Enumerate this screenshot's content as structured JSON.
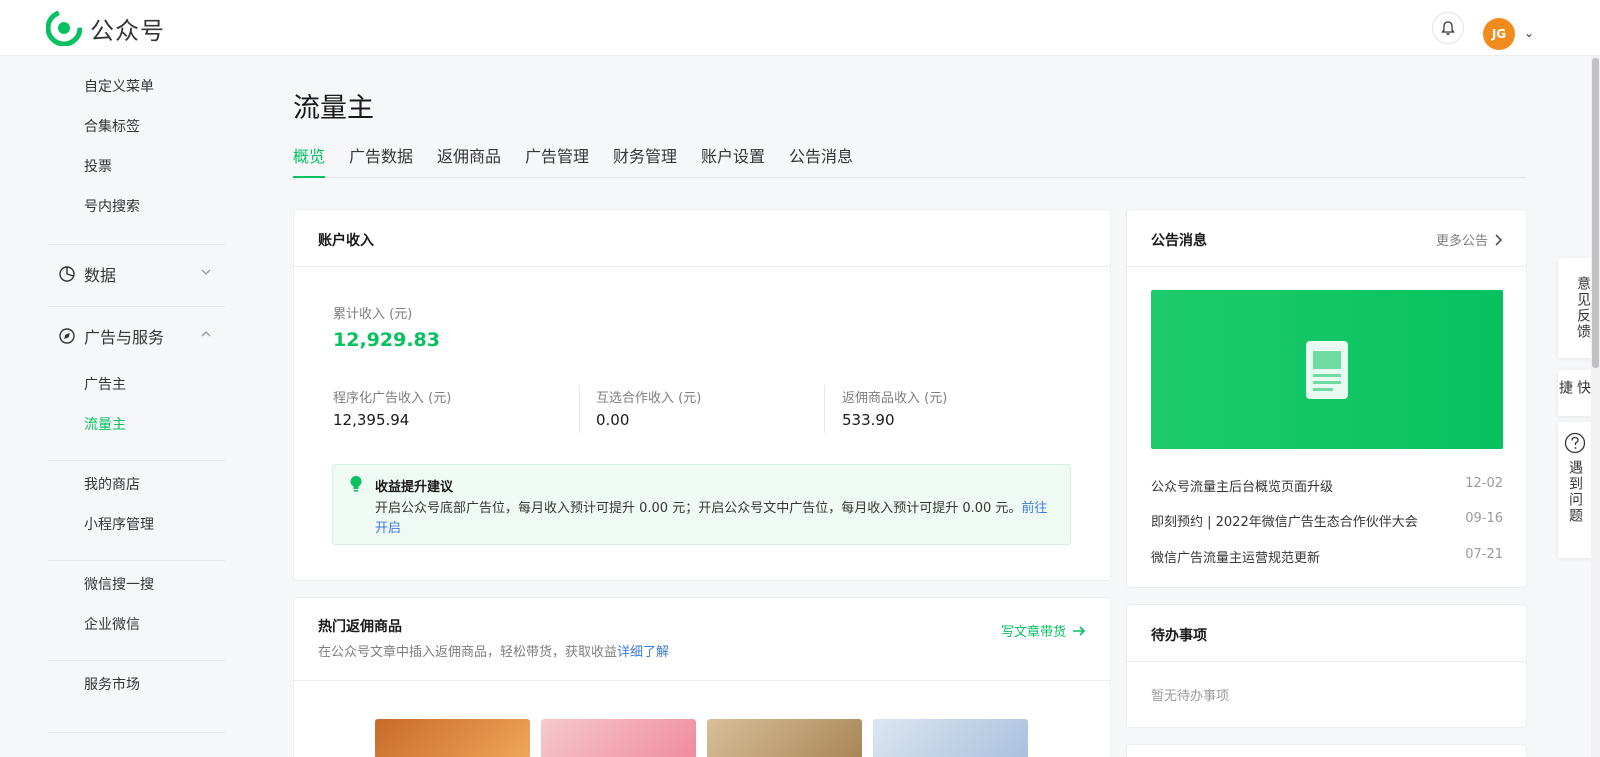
{
  "app": {
    "name": "公众号"
  },
  "header": {
    "avatar_initials": "JG"
  },
  "sidebar": {
    "items_top": [
      "自定义菜单",
      "合集标签",
      "投票",
      "号内搜索"
    ],
    "group_data": "数据",
    "group_ads": "广告与服务",
    "ads_items": [
      "广告主",
      "流量主"
    ],
    "items_mid": [
      "我的商店",
      "小程序管理"
    ],
    "items_mid2": [
      "微信搜一搜",
      "企业微信"
    ],
    "items_bottom": [
      "服务市场"
    ]
  },
  "page": {
    "title": "流量主",
    "tabs": [
      "概览",
      "广告数据",
      "返佣商品",
      "广告管理",
      "财务管理",
      "账户设置",
      "公告消息"
    ]
  },
  "income": {
    "title": "账户收入",
    "total_label": "累计收入 (元)",
    "total_value": "12,929.83",
    "program_label": "程序化广告收入 (元)",
    "program_value": "12,395.94",
    "mutual_label": "互选合作收入 (元)",
    "mutual_value": "0.00",
    "rebate_label": "返佣商品收入 (元)",
    "rebate_value": "533.90",
    "tip_title": "收益提升建议",
    "tip_body": "开启公众号底部广告位，每月收入预计可提升 0.00 元；开启公众号文中广告位，每月收入预计可提升 0.00 元。",
    "tip_link": "前往开启"
  },
  "hot_products": {
    "title": "热门返佣商品",
    "subtitle": "在公众号文章中插入返佣商品，轻松带货，获取收益",
    "subtitle_link": "详细了解",
    "action": "写文章带货"
  },
  "notices": {
    "title": "公告消息",
    "more": "更多公告",
    "items": [
      {
        "text": "公众号流量主后台概览页面升级",
        "date": "12-02"
      },
      {
        "text": "即刻预约 | 2022年微信广告生态合作伙伴大会",
        "date": "09-16"
      },
      {
        "text": "微信广告流量主运营规范更新",
        "date": "07-21"
      }
    ]
  },
  "todo": {
    "title": "待办事项",
    "empty": "暂无待办事项"
  },
  "float": {
    "feedback": "意见反馈",
    "quick": "快捷",
    "help": "遇到问题"
  },
  "colors": {
    "brand_green": "#07c160",
    "link_blue": "#3e7bde"
  }
}
